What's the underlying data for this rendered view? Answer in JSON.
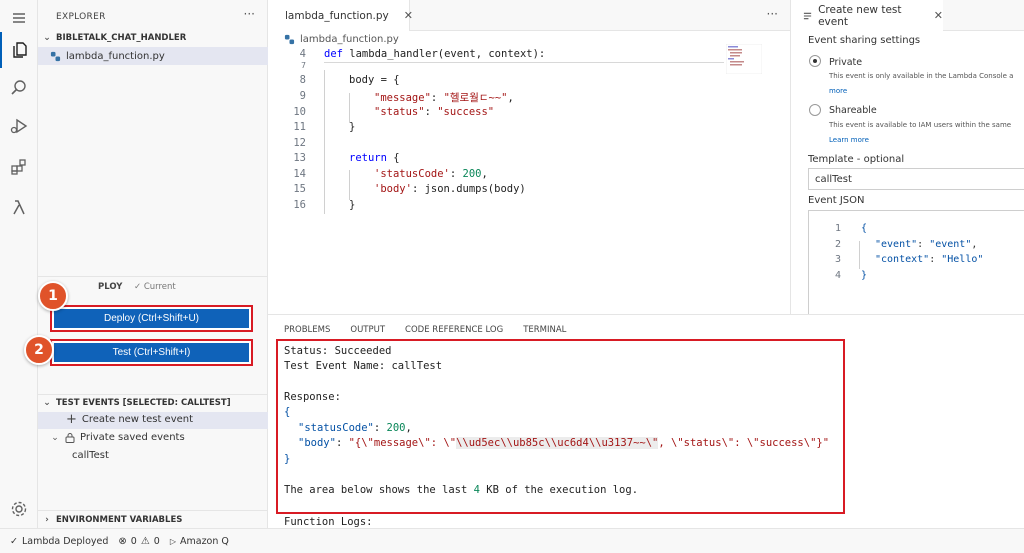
{
  "sidebar": {
    "title": "EXPLORER",
    "project": "BIBLETALK_CHAT_HANDLER",
    "file": "lambda_function.py",
    "deploy_section": "PLOY",
    "deploy_current": "✓ Current",
    "deploy_button": "Deploy (Ctrl+Shift+U)",
    "test_button": "Test (Ctrl+Shift+I)",
    "test_events_section": "TEST EVENTS [SELECTED: CALLTEST]",
    "create_event": "Create new test event",
    "private_events": "Private saved events",
    "event_name": "callTest",
    "env_section": "ENVIRONMENT VARIABLES"
  },
  "badges": {
    "one": "1",
    "two": "2"
  },
  "editor": {
    "tab": "lambda_function.py",
    "breadcrumb": "lambda_function.py",
    "lines": [
      {
        "n": "4",
        "t": ""
      },
      {
        "n": "7",
        "t": ""
      },
      {
        "n": "8",
        "t": ""
      },
      {
        "n": "9",
        "t": ""
      },
      {
        "n": "10",
        "t": ""
      },
      {
        "n": "11",
        "t": ""
      },
      {
        "n": "12",
        "t": ""
      },
      {
        "n": "13",
        "t": ""
      },
      {
        "n": "14",
        "t": ""
      },
      {
        "n": "15",
        "t": ""
      },
      {
        "n": "16",
        "t": ""
      }
    ],
    "code": {
      "l4_kw": "def",
      "l4_rest": " lambda_handler(event, context):",
      "l8": "body = {",
      "l9_key": "\"message\"",
      "l9_val": "\"헬로월ㄷ~~\"",
      "l10_key": "\"status\"",
      "l10_val": "\"success\"",
      "l11": "}",
      "l13_kw": "return",
      "l13_rest": " {",
      "l14_key": "'statusCode'",
      "l14_val": "200",
      "l15_key": "'body'",
      "l15_rest": ": json.dumps(body)",
      "l16": "}"
    }
  },
  "panel": {
    "tabs": [
      "PROBLEMS",
      "OUTPUT",
      "CODE REFERENCE LOG",
      "TERMINAL"
    ],
    "status_line": "Status: Succeeded",
    "event_line": "Test Event Name: callTest",
    "response_label": "Response:",
    "open_brace": "{",
    "status_code_key": "\"statusCode\"",
    "status_code_val": "200",
    "body_key": "\"body\"",
    "body_val_a": "\"{\\\"message\\\": \\\"",
    "body_val_hl": "\\\\ud5ec\\\\ub85c\\\\uc6d4\\\\u3137~~\\\"",
    "body_val_b": ", \\\"status\\\": \\\"success\\\"}\"",
    "close_brace": "}",
    "log_line_a": "The area below shows the last ",
    "log_line_num": "4",
    "log_line_b": " KB of the execution log.",
    "function_logs": "Function Logs:"
  },
  "right_panel": {
    "tab": "Create new test event",
    "sharing_label": "Event sharing settings",
    "private": "Private",
    "private_desc": "This event is only available in the Lambda Console a",
    "more": "more",
    "shareable": "Shareable",
    "shareable_desc": "This event is available to IAM users within the same",
    "learn_more": "Learn more",
    "template_label": "Template - optional",
    "template_value": "callTest",
    "event_json_label": "Event JSON",
    "json": {
      "l1": "{",
      "k_event": "\"event\"",
      "v_event": "\"event\"",
      "k_context": "\"context\"",
      "v_context": "\"Hello\"",
      "l4": "}"
    },
    "json_line_numbers": [
      "1",
      "2",
      "3",
      "4"
    ]
  },
  "status_bar": {
    "deployed": "Lambda Deployed",
    "errors": "0",
    "warnings": "0",
    "amazon_q": "Amazon Q"
  }
}
